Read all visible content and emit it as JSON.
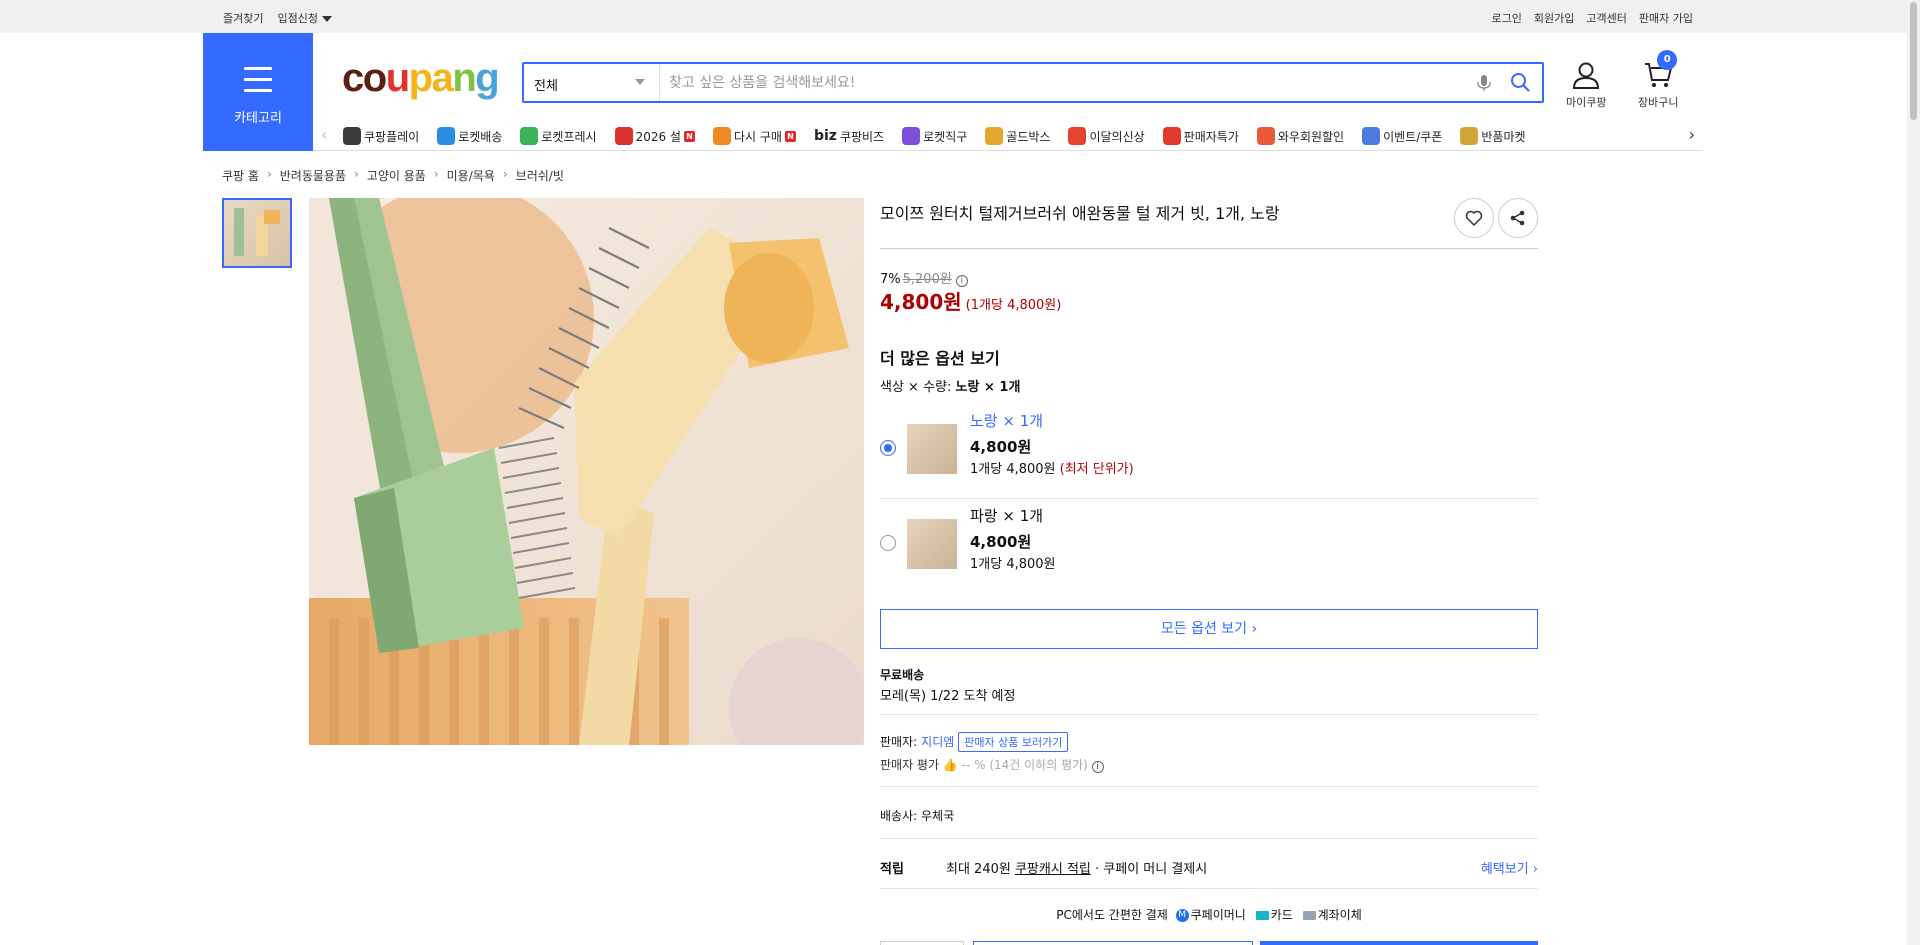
{
  "topbar": {
    "bookmark": "즐겨찾기",
    "store_apply": "입점신청",
    "login": "로그인",
    "signup": "회원가입",
    "customer_center": "고객센터",
    "seller_signup": "판매자 가입"
  },
  "header": {
    "category_label": "카테고리",
    "logo": {
      "c1": "co",
      "c2": "u",
      "c3": "pa",
      "c4": "n",
      "c5": "g"
    },
    "search_select": "전체",
    "search_placeholder": "찾고 싶은 상품을 검색해보세요!",
    "mycoupang": "마이쿠팡",
    "cart": "장바구니",
    "cart_count": "0"
  },
  "nav": [
    {
      "label": "쿠팡플레이",
      "color": "#3a3a3a"
    },
    {
      "label": "로켓배송",
      "color": "#2a8de0"
    },
    {
      "label": "로켓프레시",
      "color": "#3bb25b"
    },
    {
      "label": "2026 설",
      "color": "#d9322e",
      "badge": "N"
    },
    {
      "label": "다시 구매",
      "color": "#f08a24",
      "badge": "N"
    },
    {
      "label": "쿠팡비즈",
      "color": "#222222",
      "prefix": "biz"
    },
    {
      "label": "로켓직구",
      "color": "#7d4fd8"
    },
    {
      "label": "골드박스",
      "color": "#e2a72e"
    },
    {
      "label": "이달의신상",
      "color": "#e3432f"
    },
    {
      "label": "판매자특가",
      "color": "#e03a2c"
    },
    {
      "label": "와우회원할인",
      "color": "#e95a3a"
    },
    {
      "label": "이벤트/쿠폰",
      "color": "#4a7be0"
    },
    {
      "label": "반품마켓",
      "color": "#d1a43a"
    }
  ],
  "breadcrumb": [
    "쿠팡 홈",
    "반려동물용품",
    "고양이 용품",
    "미용/목욕",
    "브러쉬/빗"
  ],
  "product": {
    "title": "모이쯔 원터치 털제거브러쉬 애완동물 털 제거 빗, 1개, 노랑",
    "discount_rate": "7%",
    "original_price": "5,200원",
    "price": "4,800원",
    "unit_price": "(1개당 4,800원)",
    "more_options_title": "더 많은 옵션 보기",
    "option_dims": "색상 × 수량:",
    "option_selected": "노랑 × 1개",
    "options": [
      {
        "name": "노랑 × 1개",
        "price": "4,800원",
        "unit": "1개당 4,800원",
        "lowest": "(최저 단위가)",
        "selected": true
      },
      {
        "name": "파랑 × 1개",
        "price": "4,800원",
        "unit": "1개당 4,800원",
        "lowest": "",
        "selected": false
      }
    ],
    "all_options": "모든 옵션 보기 ›",
    "free_shipping": "무료배송",
    "delivery": "모레(목) 1/22 도착 예정",
    "seller_label": "판매자:",
    "seller_name": "지디엠",
    "seller_products": "판매자 상품 보러가기",
    "seller_rating_label": "판매자 평가",
    "seller_rating_value": "-- %",
    "seller_rating_note": "(14건 이하의 평가)",
    "courier_label": "배송사:",
    "courier_name": "우체국",
    "reward_label": "적립",
    "reward_text1": "최대 240원",
    "reward_text2": "쿠팡캐시 적립",
    "reward_text3": "· 쿠페이 머니 결제시",
    "reward_more": "혜택보기 ›",
    "pay_title": "PC에서도 간편한 결제",
    "pay_money": "쿠페이머니",
    "pay_card": "카드",
    "pay_bank": "계좌이체"
  },
  "colors": {
    "accent": "#346aff",
    "price": "#ae0000"
  }
}
